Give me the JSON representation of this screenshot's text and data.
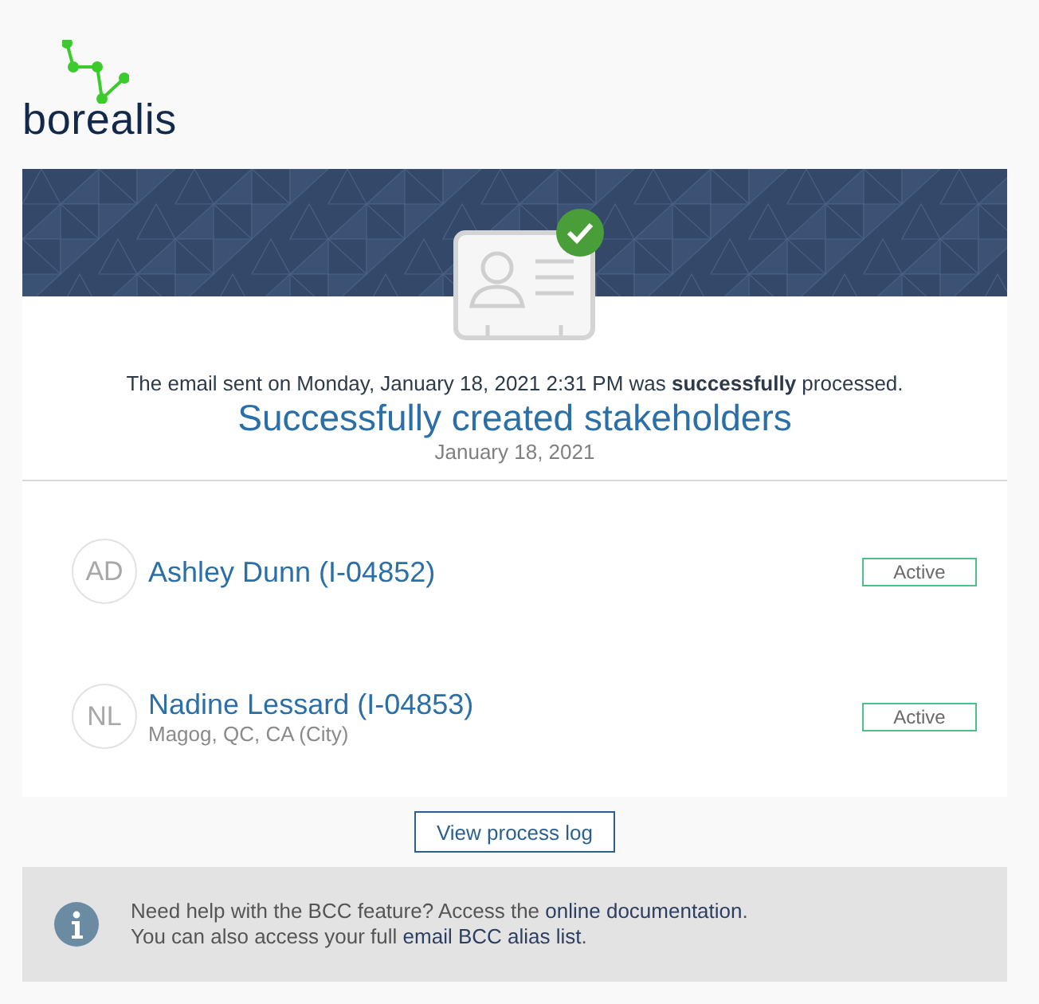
{
  "logo": {
    "text": "borealis"
  },
  "message": "The email sent on Monday, January 18, 2021 2:31 PM was **successfully** processed.",
  "title": "Successfully created stakeholders",
  "date": "January 18, 2021",
  "stakeholders": [
    {
      "initials": "AD",
      "name": "Ashley Dunn (I-04852)",
      "status": "Active"
    },
    {
      "initials": "NL",
      "name": "Nadine Lessard (I-04853)",
      "location": "Magog, QC, CA (City)",
      "status": "Active"
    }
  ],
  "button": "View process log",
  "help": [
    {
      "before": "Need help with the BCC feature? Access the ",
      "link": "online documentation",
      "after": "."
    },
    {
      "before": "You can also access your full ",
      "link": "email BCC alias list",
      "after": "."
    }
  ]
}
